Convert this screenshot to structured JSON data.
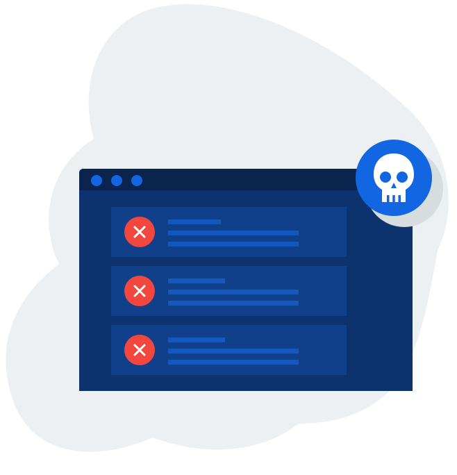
{
  "colors": {
    "background_blob": "#edf0f2",
    "window_body": "#0c336d",
    "window_titlebar": "#0a244d",
    "window_dots": "#1565e0",
    "error_row": "#104089",
    "placeholder_lines": "#1458c0",
    "error_badge": "#f1473f",
    "skull_badge": "#1266e2",
    "skull": "#ffffff"
  },
  "icons": {
    "window_controls": "circle-dot-icon",
    "error": "x-circle-icon",
    "threat": "skull-icon"
  },
  "error_list": {
    "items": [
      {
        "status": "error"
      },
      {
        "status": "error"
      },
      {
        "status": "error"
      }
    ]
  }
}
